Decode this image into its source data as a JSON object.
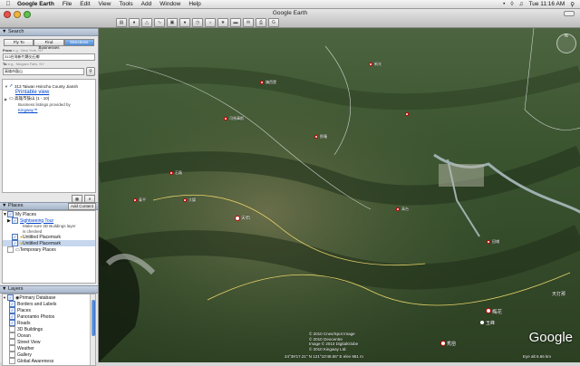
{
  "menubar": {
    "app_name": "Google Earth",
    "items": [
      "File",
      "Edit",
      "View",
      "Tools",
      "Add",
      "Window",
      "Help"
    ],
    "clock": "Tue 11:16 AM"
  },
  "window": {
    "title": "Google Earth"
  },
  "search": {
    "header": "Search",
    "tabs": [
      "Fly To",
      "Find Businesses",
      "Directions"
    ],
    "active_tab": "Directions",
    "from_label": "From",
    "from_example": "e.g., New York, NY",
    "from_value": "313台灣新竹縣尖石鄉",
    "to_label": "To",
    "to_placeholder": "e.g., Niagara Falls, NY",
    "to_value": "高雄市鼓山",
    "results": [
      {
        "label": "313 Taiwan Hsinchu County Jiansh",
        "link": "Printable view"
      },
      {
        "label": "高雄市鼓山 (1 - 10)",
        "note": "Business listings provided by",
        "provider": "Kingway™"
      }
    ]
  },
  "places": {
    "header": "Places",
    "add_button": "Add Content",
    "items": [
      {
        "label": "My Places",
        "checked": true
      },
      {
        "label": "Sightseeing Tour",
        "note": "Make sure 3D Buildings layer is checked",
        "checked": true
      },
      {
        "label": "Untitled Placemark",
        "checked": true
      },
      {
        "label": "Untitled Placemark",
        "checked": true,
        "selected": true
      },
      {
        "label": "Temporary Places",
        "checked": false
      }
    ]
  },
  "layers": {
    "header": "Layers",
    "items": [
      {
        "label": "Primary Database",
        "checked": true
      },
      {
        "label": "Borders and Labels",
        "checked": true
      },
      {
        "label": "Places",
        "checked": true
      },
      {
        "label": "Panoramio Photos",
        "checked": true
      },
      {
        "label": "Roads",
        "checked": true
      },
      {
        "label": "3D Buildings",
        "checked": false
      },
      {
        "label": "Ocean",
        "checked": false
      },
      {
        "label": "Street View",
        "checked": false
      },
      {
        "label": "Weather",
        "checked": false
      },
      {
        "label": "Gallery",
        "checked": false
      },
      {
        "label": "Global Awareness",
        "checked": false
      }
    ]
  },
  "map": {
    "labels": [
      "尖石",
      "秀巒",
      "玉峰",
      "梅花",
      "天打那",
      "那羅",
      "新光",
      "石磊",
      "大錦",
      "泰平",
      "高台",
      "田埔",
      "鎮西堡",
      "司馬庫斯"
    ],
    "copyright": [
      "© 2010 Cnes/Spot Image",
      "© 2010 Geocentre",
      "Image © 2010 DigitalGlobe",
      "© 2010 Kingway Ltd."
    ],
    "status": {
      "coords": "24°39'17.21\" N  121°10'48.55\" E  elev 951 m",
      "eye_alt": "Eye alt  6.66 km"
    },
    "logo": "Google",
    "compass_n": "N"
  },
  "colors": {
    "selected_tab": "#4e8ad8",
    "link": "#0044cc",
    "map_terrain": "#3f5a2f"
  }
}
